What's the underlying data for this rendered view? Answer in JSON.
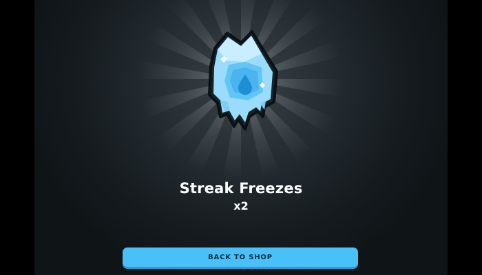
{
  "reward": {
    "icon": "streak-freeze-icon",
    "title": "Streak Freezes",
    "quantity": "x2"
  },
  "actions": {
    "back_label": "BACK TO SHOP"
  },
  "colors": {
    "button": "#49c0f8",
    "background": "#151b1f",
    "ice_light": "#bfe9ff",
    "ice_mid": "#62c6f5",
    "ice_dark": "#1e8fd6"
  }
}
